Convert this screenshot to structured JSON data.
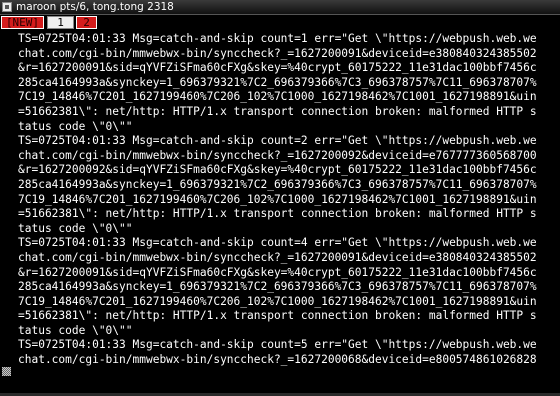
{
  "window": {
    "title": "maroon pts/6, tong.tong 2318"
  },
  "tabs": [
    {
      "label": "[NEW]"
    },
    {
      "label": "1"
    },
    {
      "label": "2"
    }
  ],
  "terminal": {
    "lines": [
      "TS=0725T04:01:33 Msg=catch-and-skip count=1 err=\"Get \\\"https://webpush.web.we",
      "chat.com/cgi-bin/mmwebwx-bin/synccheck?_=1627200091&deviceid=e380840324385502",
      "&r=1627200091&sid=qYVFZiSFma60cFXg&skey=%40crypt_60175222_11e31dac100bbf7456c",
      "285ca4164993a&synckey=1_696379321%7C2_696379366%7C3_696378757%7C11_696378707%",
      "7C19_14846%7C201_1627199460%7C206_102%7C1000_1627198462%7C1001_1627198891&uin",
      "=51662381\\\": net/http: HTTP/1.x transport connection broken: malformed HTTP s",
      "tatus code \\\"0\\\"\"",
      "TS=0725T04:01:33 Msg=catch-and-skip count=2 err=\"Get \\\"https://webpush.web.we",
      "chat.com/cgi-bin/mmwebwx-bin/synccheck?_=1627200092&deviceid=e767777360568700",
      "&r=1627200092&sid=qYVFZiSFma60cFXg&skey=%40crypt_60175222_11e31dac100bbf7456c",
      "285ca4164993a&synckey=1_696379321%7C2_696379366%7C3_696378757%7C11_696378707%",
      "7C19_14846%7C201_1627199460%7C206_102%7C1000_1627198462%7C1001_1627198891&uin",
      "=51662381\\\": net/http: HTTP/1.x transport connection broken: malformed HTTP s",
      "tatus code \\\"0\\\"\"",
      "TS=0725T04:01:33 Msg=catch-and-skip count=4 err=\"Get \\\"https://webpush.web.we",
      "chat.com/cgi-bin/mmwebwx-bin/synccheck?_=1627200091&deviceid=e380840324385502",
      "&r=1627200091&sid=qYVFZiSFma60cFXg&skey=%40crypt_60175222_11e31dac100bbf7456c",
      "285ca4164993a&synckey=1_696379321%7C2_696379366%7C3_696378757%7C11_696378707%",
      "7C19_14846%7C201_1627199460%7C206_102%7C1000_1627198462%7C1001_1627198891&uin",
      "=51662381\\\": net/http: HTTP/1.x transport connection broken: malformed HTTP s",
      "tatus code \\\"0\\\"\"",
      "TS=0725T04:01:33 Msg=catch-and-skip count=5 err=\"Get \\\"https://webpush.web.we",
      "chat.com/cgi-bin/mmwebwx-bin/synccheck?_=1627200068&deviceid=e800574861026828"
    ]
  }
}
